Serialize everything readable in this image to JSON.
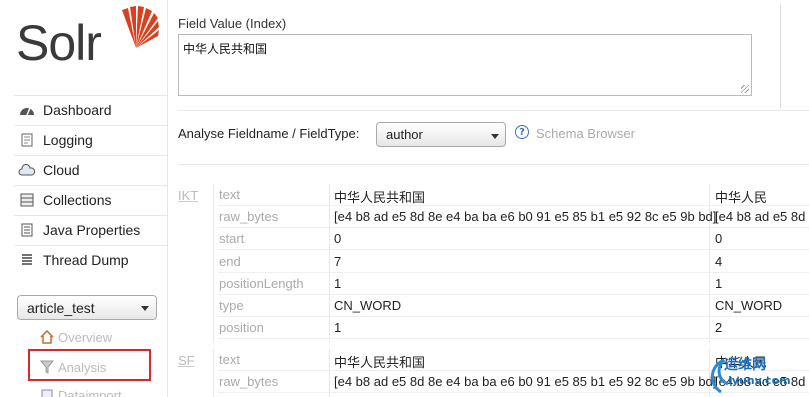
{
  "brand": {
    "logo_text": "Solr"
  },
  "sidebar": {
    "nav": [
      {
        "label": "Dashboard",
        "icon": "dashboard-icon"
      },
      {
        "label": "Logging",
        "icon": "logging-icon"
      },
      {
        "label": "Cloud",
        "icon": "cloud-icon"
      },
      {
        "label": "Collections",
        "icon": "collections-icon"
      },
      {
        "label": "Java Properties",
        "icon": "java-properties-icon"
      },
      {
        "label": "Thread Dump",
        "icon": "thread-dump-icon"
      }
    ],
    "core_selector": {
      "value": "article_test"
    },
    "core_menu": [
      {
        "label": "Overview",
        "icon": "overview-icon"
      },
      {
        "label": "Analysis",
        "icon": "analysis-icon",
        "selected": true
      },
      {
        "label": "Dataimport",
        "icon": "dataimport-icon"
      }
    ]
  },
  "main": {
    "field_value_label": "Field Value (Index)",
    "field_value": "中华人民共和国",
    "fieldname_label": "Analyse Fieldname / FieldType:",
    "fieldtype_value": "author",
    "help_glyph": "?",
    "schema_browser_label": "Schema Browser"
  },
  "analysis": [
    {
      "stage": "IKT",
      "rows": [
        {
          "key": "text",
          "v1": "中华人民共和国",
          "v2": "中华人民"
        },
        {
          "key": "raw_bytes",
          "v1": "[e4 b8 ad e5 8d 8e e4 ba ba e6 b0 91 e5 85 b1 e5 92 8c e5 9b bd]",
          "v2": "[e4 b8 ad e5 8d 8e"
        },
        {
          "key": "start",
          "v1": "0",
          "v2": "0"
        },
        {
          "key": "end",
          "v1": "7",
          "v2": "4"
        },
        {
          "key": "positionLength",
          "v1": "1",
          "v2": "1"
        },
        {
          "key": "type",
          "v1": "CN_WORD",
          "v2": "CN_WORD"
        },
        {
          "key": "position",
          "v1": "1",
          "v2": "2"
        }
      ]
    },
    {
      "stage": "SF",
      "rows": [
        {
          "key": "text",
          "v1": "中华人民共和国",
          "v2": "中华人民"
        },
        {
          "key": "raw_bytes",
          "v1": "[e4 b8 ad e5 8d 8e e4 ba ba e6 b0 91 e5 85 b1 e5 92 8c e5 9b bd]",
          "v2": "[e4 b8 ad e5 8d 8e"
        }
      ]
    }
  ],
  "watermark": {
    "line1": "运维网",
    "line2": "iyunv.com"
  },
  "colors": {
    "highlight": "#d9282a",
    "logo_accent": "#d9411e",
    "link_blue": "#3a6fc4"
  }
}
